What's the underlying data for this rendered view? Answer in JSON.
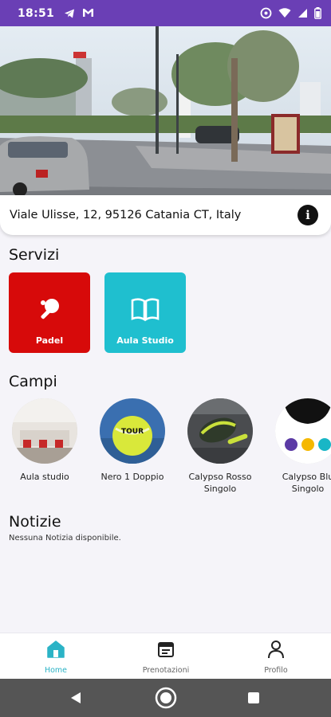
{
  "status_bar": {
    "time": "18:51"
  },
  "address": {
    "text": "Viale Ulisse, 12, 95126 Catania CT, Italy"
  },
  "servizi": {
    "title": "Servizi",
    "items": [
      {
        "label": "Padel",
        "color": "#d70a0a",
        "icon": "ping-pong-icon"
      },
      {
        "label": "Aula Studio",
        "color": "#1fbfcf",
        "icon": "book-icon"
      }
    ]
  },
  "campi": {
    "title": "Campi",
    "items": [
      {
        "label": "Aula studio"
      },
      {
        "label": "Nero 1 Doppio"
      },
      {
        "label": "Calypso Rosso Singolo"
      },
      {
        "label": "Calypso Blu Singolo"
      }
    ]
  },
  "notizie": {
    "title": "Notizie",
    "empty": "Nessuna Notizia disponibile."
  },
  "bottom_nav": {
    "items": [
      {
        "label": "Home",
        "icon": "home-icon",
        "active": true
      },
      {
        "label": "Prenotazioni",
        "icon": "calendar-icon",
        "active": false
      },
      {
        "label": "Profilo",
        "icon": "person-icon",
        "active": false
      }
    ]
  },
  "colors": {
    "accent": "#2bb3c6",
    "status_bar": "#6a3fb5",
    "padel": "#d70a0a",
    "aula": "#1fbfcf"
  }
}
